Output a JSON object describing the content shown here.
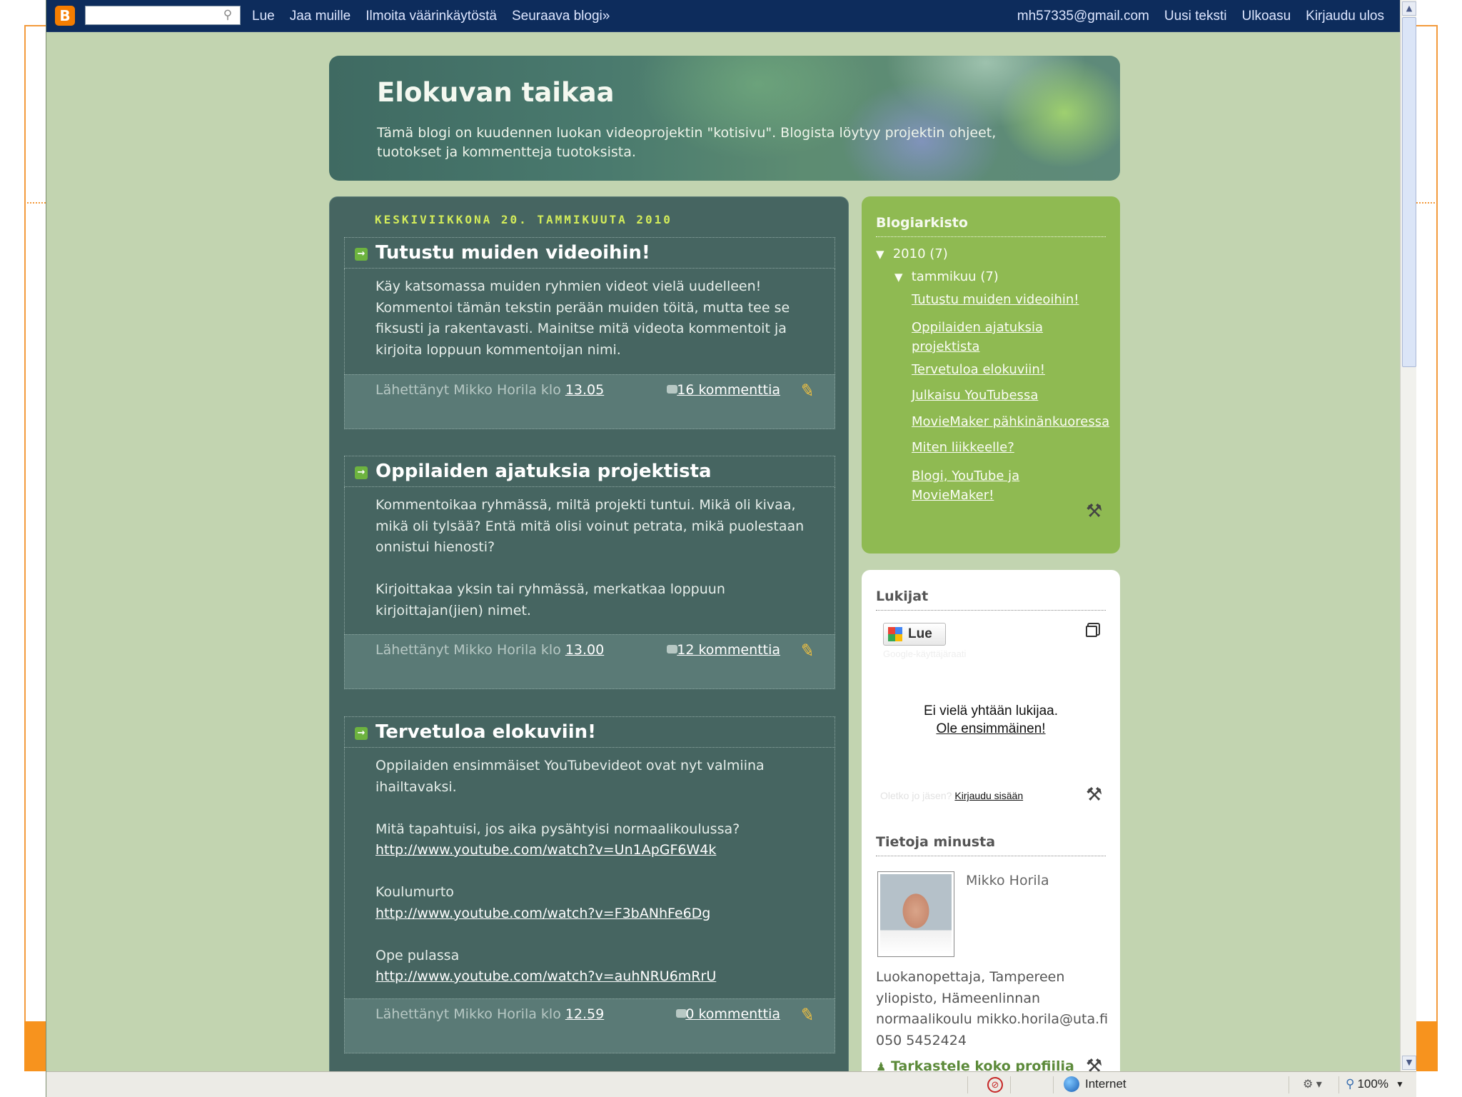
{
  "navbar": {
    "logo": "B",
    "search_value": "",
    "links": [
      "Lue",
      "Jaa muille",
      "Ilmoita väärinkäytöstä",
      "Seuraava blogi»"
    ],
    "email": "mh57335@gmail.com",
    "right_links": [
      "Uusi teksti",
      "Ulkoasu",
      "Kirjaudu ulos"
    ]
  },
  "header": {
    "title": "Elokuvan taikaa",
    "description": "Tämä blogi on kuudennen luokan videoprojektin \"kotisivu\". Blogista löytyy projektin ohjeet, tuotokset ja kommentteja tuotoksista."
  },
  "date_header": "KESKIVIIKKONA 20. TAMMIKUUTA 2010",
  "posts": [
    {
      "title": "Tutustu muiden videoihin!",
      "paragraphs": [
        "Käy katsomassa muiden ryhmien videot vielä uudelleen! Kommentoi tämän tekstin perään muiden töitä, mutta tee se fiksusti ja rakentavasti. Mainitse mitä videota kommentoit ja kirjoita loppuun kommentoijan nimi."
      ],
      "meta": "Lähettänyt Mikko Horila klo",
      "time": "13.05",
      "comments": "16 kommenttia"
    },
    {
      "title": "Oppilaiden ajatuksia projektista",
      "paragraphs": [
        "Kommentoikaa ryhmässä, miltä projekti tuntui. Mikä oli kivaa, mikä oli tylsää? Entä mitä olisi voinut petrata, mikä puolestaan onnistui hienosti?",
        "Kirjoittakaa yksin tai ryhmässä, merkatkaa loppuun kirjoittajan(jien) nimet."
      ],
      "meta": "Lähettänyt Mikko Horila klo",
      "time": "13.00",
      "comments": "12 kommenttia"
    },
    {
      "title": "Tervetuloa elokuviin!",
      "paragraphs": [
        "Oppilaiden ensimmäiset YouTubevideot ovat nyt valmiina ihailtavaksi.",
        "Mitä tapahtuisi, jos aika pysähtyisi normaalikoulussa?",
        "Koulumurto",
        "Ope pulassa"
      ],
      "links": [
        "http://www.youtube.com/watch?v=Un1ApGF6W4k",
        "http://www.youtube.com/watch?v=F3bANhFe6Dg",
        "http://www.youtube.com/watch?v=auhNRU6mRrU"
      ],
      "meta": "Lähettänyt Mikko Horila klo",
      "time": "12.59",
      "comments": "0 kommenttia"
    }
  ],
  "archive": {
    "title": "Blogiarkisto",
    "year": "2010",
    "year_count": "(7)",
    "month": "tammikuu",
    "month_count": "(7)",
    "posts": [
      "Tutustu muiden videoihin!",
      "Oppilaiden ajatuksia projektista",
      "Tervetuloa elokuviin!",
      "Julkaisu YouTubessa",
      "MovieMaker pähkinänkuoressa",
      "Miten liikkeelle?",
      "Blogi, YouTube ja MovieMaker!"
    ]
  },
  "followers": {
    "title": "Lukijat",
    "button": "Lue",
    "sub": "Google-käyttäjäraati",
    "empty_line": "Ei vielä yhtään lukijaa.",
    "first_link": "Ole ensimmäinen!",
    "member_question": "Oletko jo jäsen?",
    "login_link": "Kirjaudu sisään"
  },
  "about": {
    "title": "Tietoja minusta",
    "name": "Mikko Horila",
    "description": "Luokanopettaja, Tampereen yliopisto, Hämeenlinnan normaalikoulu mikko.horila@uta.fi 050 5452424",
    "profile_link": "Tarkastele koko profiilia"
  },
  "statusbar": {
    "zone": "Internet",
    "zoom": "100%"
  }
}
